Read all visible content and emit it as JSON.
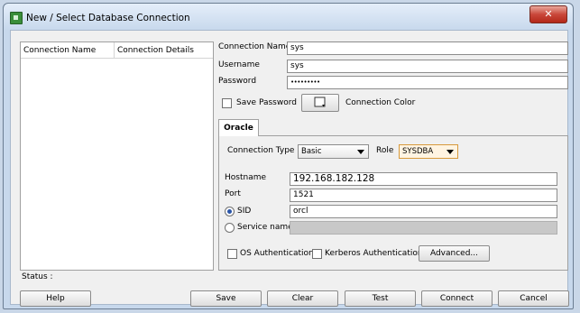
{
  "window": {
    "title": "New / Select Database Connection",
    "close_glyph": "✕"
  },
  "list": {
    "col_name": "Connection Name",
    "col_details": "Connection Details"
  },
  "form": {
    "conn_name_label": "Connection Name",
    "conn_name_value": "sys",
    "username_label": "Username",
    "username_value": "sys",
    "password_label": "Password",
    "password_value": "•••••••••",
    "save_password_label": "Save Password",
    "connection_color_label": "Connection Color"
  },
  "tabs": {
    "oracle": "Oracle"
  },
  "oracle": {
    "conn_type_label": "Connection Type",
    "conn_type_value": "Basic",
    "role_label": "Role",
    "role_value": "SYSDBA",
    "hostname_label": "Hostname",
    "hostname_value": "192.168.182.128",
    "port_label": "Port",
    "port_value": "1521",
    "sid_label": "SID",
    "sid_value": "orcl",
    "service_name_label": "Service name",
    "os_auth_label": "OS Authentication",
    "kerberos_label": "Kerberos Authentication",
    "advanced_button": "Advanced..."
  },
  "status": {
    "label": "Status :"
  },
  "buttons": {
    "help": "Help",
    "save": "Save",
    "clear": "Clear",
    "test": "Test",
    "connect": "Connect",
    "cancel": "Cancel"
  },
  "colors": {
    "role_highlight": "#fff4e2",
    "close_button": "#c9473a"
  }
}
